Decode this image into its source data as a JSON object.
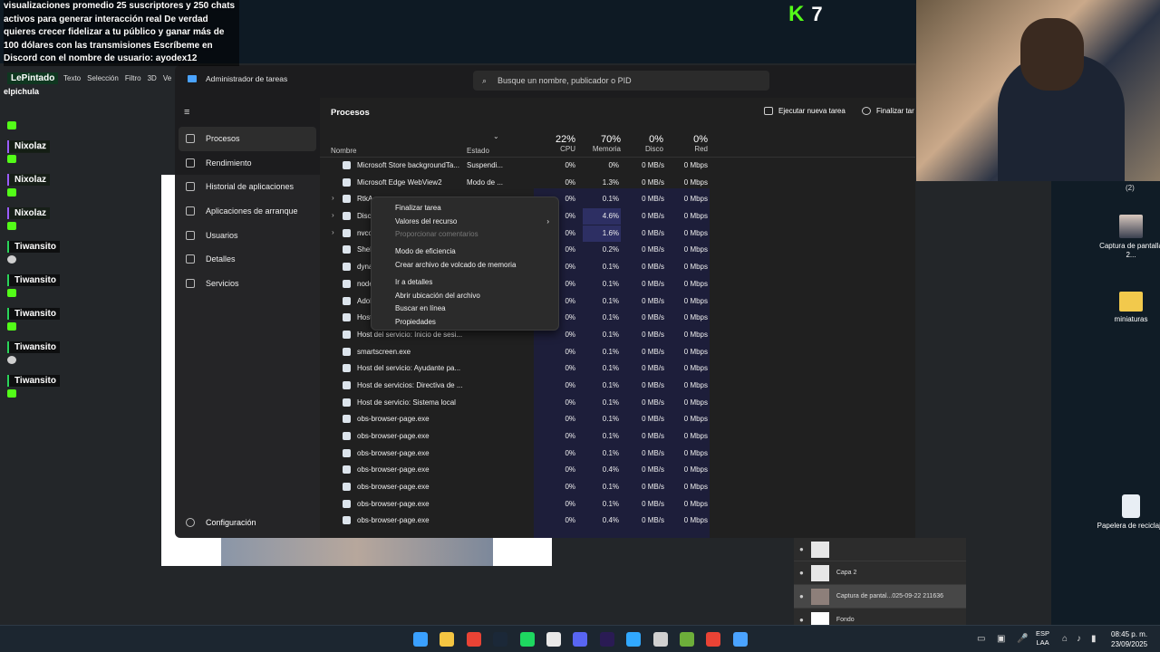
{
  "overlay": {
    "message": "visualizaciones promedio 25 suscriptores y 250 chats activos para generar interacción real De verdad quieres crecer fidelizar a tu público y ganar más de 100 dólares con las transmisiones Escríbeme en Discord con el nombre de usuario: ayodex12",
    "top_user": "LePintado",
    "sub_user": "elpichula",
    "kick_count": "7",
    "kick_logo": "K"
  },
  "chat": [
    {
      "name": "Nixolaz",
      "badge": "green"
    },
    {
      "name": "Nixolaz",
      "badge": "green"
    },
    {
      "name": "Nixolaz",
      "badge": "green"
    },
    {
      "name": "Nixolaz",
      "badge": "green"
    },
    {
      "name": "Tiwansito",
      "badge": "white"
    },
    {
      "name": "Tiwansito",
      "badge": "green"
    },
    {
      "name": "Tiwansito",
      "badge": "green"
    },
    {
      "name": "Tiwansito",
      "badge": "white"
    },
    {
      "name": "Tiwansito",
      "badge": "green"
    }
  ],
  "photoshop": {
    "menu": [
      "Texto",
      "Selección",
      "Filtro",
      "3D",
      "Ve"
    ],
    "layers": [
      {
        "name": ""
      },
      {
        "name": "Capa 2"
      },
      {
        "name": "Captura de pantal...025-09-22 211636"
      },
      {
        "name": "Fondo"
      }
    ]
  },
  "taskmanager": {
    "title": "Administrador de tareas",
    "search_placeholder": "Busque un nombre, publicador o PID",
    "nav": [
      {
        "label": "Procesos",
        "icon": "processes-icon"
      },
      {
        "label": "Rendimiento",
        "icon": "performance-icon"
      },
      {
        "label": "Historial de aplicaciones",
        "icon": "history-icon"
      },
      {
        "label": "Aplicaciones de arranque",
        "icon": "startup-icon"
      },
      {
        "label": "Usuarios",
        "icon": "users-icon"
      },
      {
        "label": "Detalles",
        "icon": "details-icon"
      },
      {
        "label": "Servicios",
        "icon": "services-icon"
      }
    ],
    "config_label": "Configuración",
    "section_title": "Procesos",
    "run_new_task": "Ejecutar nueva tarea",
    "end_task": "Finalizar tar",
    "columns": {
      "name": "Nombre",
      "status": "Estado",
      "cpu_pct": "22%",
      "cpu": "CPU",
      "mem_pct": "70%",
      "mem": "Memoria",
      "disk_pct": "0%",
      "disk": "Disco",
      "net_pct": "0%",
      "net": "Red"
    },
    "processes": [
      {
        "name": "Microsoft Store backgroundTa...",
        "status": "Suspendi...",
        "cpu": "0%",
        "mem": "0%",
        "disk": "0 MB/s",
        "net": "0 Mbps",
        "expand": false
      },
      {
        "name": "Microsoft Edge WebView2",
        "status": "Modo de ...",
        "cpu": "0%",
        "mem": "1.3%",
        "disk": "0 MB/s",
        "net": "0 Mbps",
        "expand": false
      },
      {
        "name": "RtkA",
        "status": "",
        "cpu": "0%",
        "mem": "0.1%",
        "disk": "0 MB/s",
        "net": "0 Mbps",
        "expand": true
      },
      {
        "name": "Disco",
        "status": "",
        "cpu": "0%",
        "mem": "4.6%",
        "disk": "0 MB/s",
        "net": "0 Mbps",
        "expand": true
      },
      {
        "name": "nvco",
        "status": "",
        "cpu": "0%",
        "mem": "1.6%",
        "disk": "0 MB/s",
        "net": "0 Mbps",
        "expand": true
      },
      {
        "name": "Shel",
        "status": "",
        "cpu": "0%",
        "mem": "0.2%",
        "disk": "0 MB/s",
        "net": "0 Mbps",
        "expand": false
      },
      {
        "name": "dyna",
        "status": "",
        "cpu": "0%",
        "mem": "0.1%",
        "disk": "0 MB/s",
        "net": "0 Mbps",
        "expand": false
      },
      {
        "name": "node",
        "status": "",
        "cpu": "0%",
        "mem": "0.1%",
        "disk": "0 MB/s",
        "net": "0 Mbps",
        "expand": false
      },
      {
        "name": "Adol",
        "status": "",
        "cpu": "0%",
        "mem": "0.1%",
        "disk": "0 MB/s",
        "net": "0 Mbps",
        "expand": false
      },
      {
        "name": "Host",
        "status": "",
        "cpu": "0%",
        "mem": "0.1%",
        "disk": "0 MB/s",
        "net": "0 Mbps",
        "expand": false
      },
      {
        "name": "Host del servicio: Inicio de sesi...",
        "status": "",
        "cpu": "0%",
        "mem": "0.1%",
        "disk": "0 MB/s",
        "net": "0 Mbps",
        "expand": false
      },
      {
        "name": "smartscreen.exe",
        "status": "",
        "cpu": "0%",
        "mem": "0.1%",
        "disk": "0 MB/s",
        "net": "0 Mbps",
        "expand": false
      },
      {
        "name": "Host del servicio: Ayudante pa...",
        "status": "",
        "cpu": "0%",
        "mem": "0.1%",
        "disk": "0 MB/s",
        "net": "0 Mbps",
        "expand": false
      },
      {
        "name": "Host de servicios: Directiva de ...",
        "status": "",
        "cpu": "0%",
        "mem": "0.1%",
        "disk": "0 MB/s",
        "net": "0 Mbps",
        "expand": false
      },
      {
        "name": "Host de servicio: Sistema local",
        "status": "",
        "cpu": "0%",
        "mem": "0.1%",
        "disk": "0 MB/s",
        "net": "0 Mbps",
        "expand": false
      },
      {
        "name": "obs-browser-page.exe",
        "status": "",
        "cpu": "0%",
        "mem": "0.1%",
        "disk": "0 MB/s",
        "net": "0 Mbps",
        "expand": false
      },
      {
        "name": "obs-browser-page.exe",
        "status": "",
        "cpu": "0%",
        "mem": "0.1%",
        "disk": "0 MB/s",
        "net": "0 Mbps",
        "expand": false
      },
      {
        "name": "obs-browser-page.exe",
        "status": "",
        "cpu": "0%",
        "mem": "0.1%",
        "disk": "0 MB/s",
        "net": "0 Mbps",
        "expand": false
      },
      {
        "name": "obs-browser-page.exe",
        "status": "",
        "cpu": "0%",
        "mem": "0.4%",
        "disk": "0 MB/s",
        "net": "0 Mbps",
        "expand": false
      },
      {
        "name": "obs-browser-page.exe",
        "status": "",
        "cpu": "0%",
        "mem": "0.1%",
        "disk": "0 MB/s",
        "net": "0 Mbps",
        "expand": false
      },
      {
        "name": "obs-browser-page.exe",
        "status": "",
        "cpu": "0%",
        "mem": "0.1%",
        "disk": "0 MB/s",
        "net": "0 Mbps",
        "expand": false
      },
      {
        "name": "obs-browser-page.exe",
        "status": "",
        "cpu": "0%",
        "mem": "0.4%",
        "disk": "0 MB/s",
        "net": "0 Mbps",
        "expand": false
      }
    ],
    "context_menu": [
      {
        "label": "Finalizar tarea",
        "disabled": false,
        "submenu": false
      },
      {
        "label": "Valores del recurso",
        "disabled": false,
        "submenu": true
      },
      {
        "label": "Proporcionar comentarios",
        "disabled": true,
        "submenu": false
      },
      {
        "label": "Modo de eficiencia",
        "disabled": false,
        "submenu": false
      },
      {
        "label": "Crear archivo de volcado de memoria",
        "disabled": false,
        "submenu": false
      },
      {
        "label": "Ir a detalles",
        "disabled": false,
        "submenu": false
      },
      {
        "label": "Abrir ubicación del archivo",
        "disabled": false,
        "submenu": false
      },
      {
        "label": "Buscar en línea",
        "disabled": false,
        "submenu": false
      },
      {
        "label": "Propiedades",
        "disabled": false,
        "submenu": false
      }
    ]
  },
  "desktop": {
    "notif_count": "(2)",
    "icons": [
      {
        "label": "Captura de pantalla 2...",
        "icon": "screenshot-file-icon"
      },
      {
        "label": "miniaturas",
        "icon": "folder-icon"
      },
      {
        "label": "Papelera de reciclaje",
        "icon": "recycle-bin-icon"
      }
    ]
  },
  "taskbar": {
    "apps": [
      "windows-start-icon",
      "file-explorer-icon",
      "chrome-icon",
      "steam-icon",
      "spotify-icon",
      "capcut-icon",
      "discord-icon",
      "premiere-icon",
      "photoshop-icon",
      "obs-icon",
      "minecraft-icon",
      "chrome-alt-icon",
      "task-manager-icon"
    ],
    "app_colors": [
      "#3aa0ff",
      "#f4c542",
      "#e94335",
      "#1b2838",
      "#1ed760",
      "#e9e9e9",
      "#5865f2",
      "#2a1b54",
      "#31a8ff",
      "#d0d0d0",
      "#6dae3a",
      "#e94335",
      "#4aa3ff"
    ],
    "lang_top": "ESP",
    "lang_bottom": "LAA",
    "time": "08:45 p. m.",
    "date": "23/09/2025"
  }
}
